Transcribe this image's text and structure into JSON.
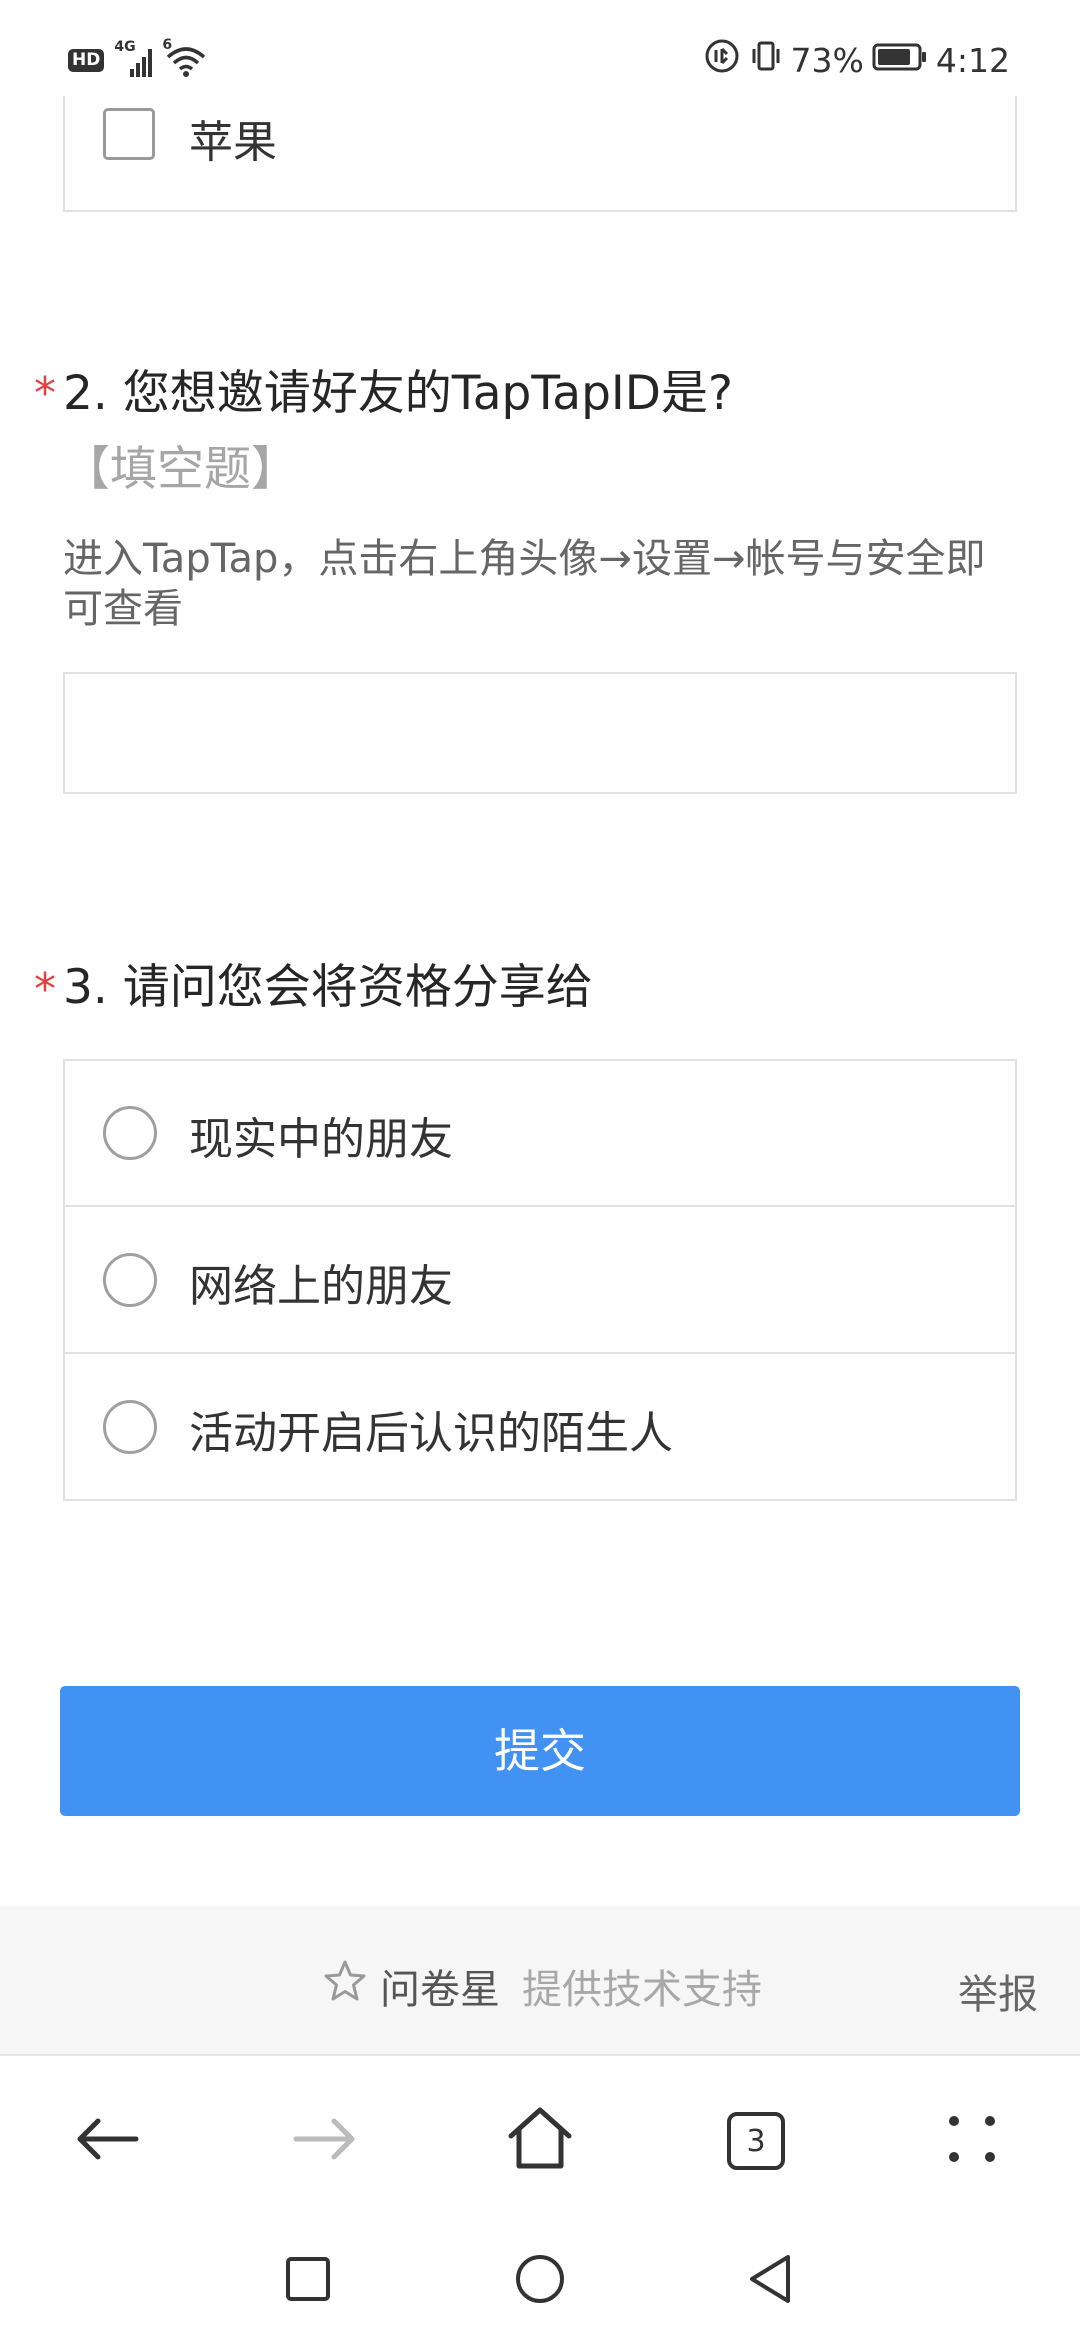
{
  "status_bar": {
    "hd_badge": "HD",
    "network": "4G",
    "wifi_badge": "6",
    "battery_percent": "73%",
    "time": "4:12"
  },
  "question1": {
    "visible_option": "苹果"
  },
  "question2": {
    "required_mark": "*",
    "title": "2. 您想邀请好友的TapTapID是?",
    "type_tag": "【填空题】",
    "description": "进入TapTap，点击右上角头像→设置→帐号与安全即可查看",
    "input_value": ""
  },
  "question3": {
    "required_mark": "*",
    "title": "3. 请问您会将资格分享给",
    "options": [
      {
        "label": "现实中的朋友"
      },
      {
        "label": "网络上的朋友"
      },
      {
        "label": "活动开启后认识的陌生人"
      }
    ]
  },
  "submit_label": "提交",
  "footer": {
    "brand": "问卷星",
    "credit": "提供技术支持",
    "report": "举报"
  },
  "browser_nav": {
    "tab_count": "3"
  },
  "colors": {
    "primary": "#4292f3",
    "required": "#e54040",
    "muted": "#a6a6a6"
  }
}
